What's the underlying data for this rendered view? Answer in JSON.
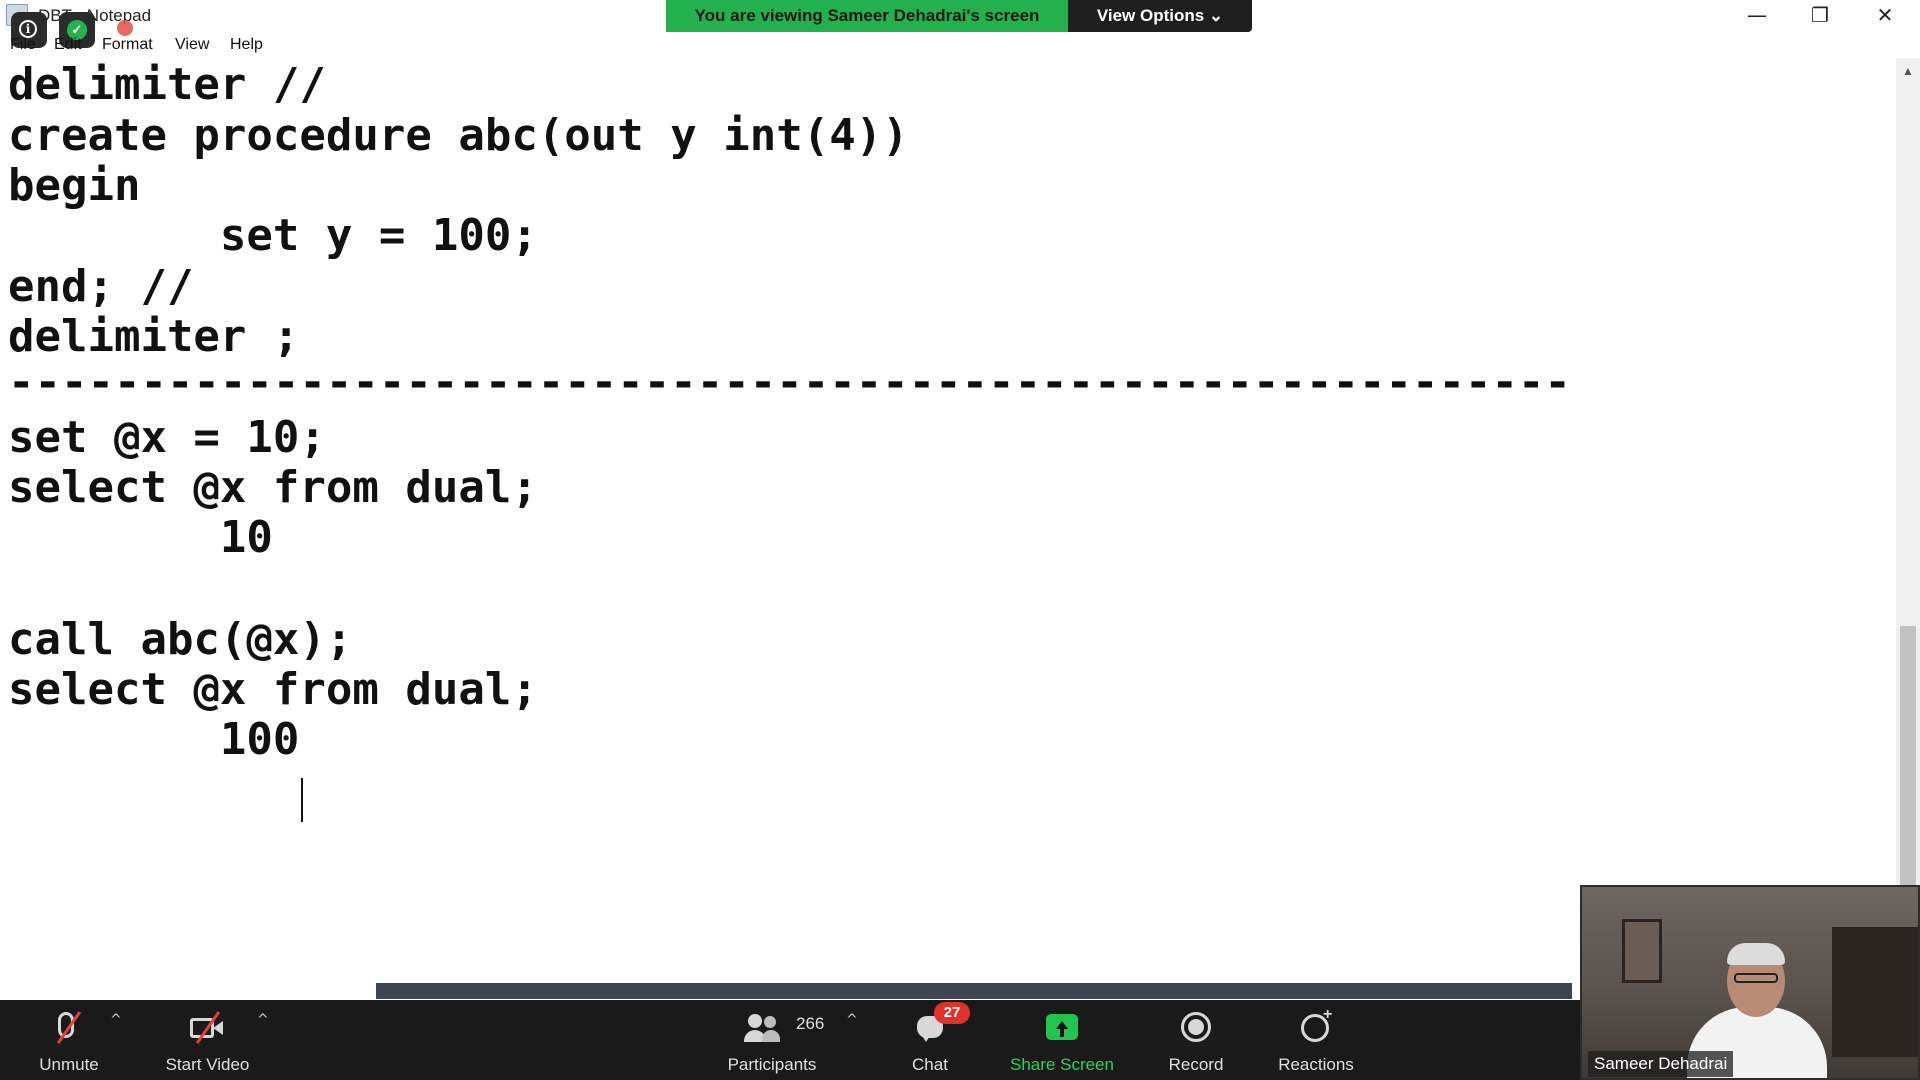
{
  "window": {
    "title": "DBT - Notepad",
    "minimize_glyph": "—",
    "maximize_glyph": "❐",
    "close_glyph": "✕"
  },
  "share_banner": {
    "viewing_text": "You are viewing Sameer Dehadrai's screen",
    "view_options_label": "View Options ⌄"
  },
  "overlay_icons": {
    "info": "i",
    "shield": "✓"
  },
  "menu": {
    "items": [
      "File",
      "Edit",
      "Format",
      "View",
      "Help"
    ]
  },
  "editor": {
    "lines": [
      "delimiter //",
      "create procedure abc(out y int(4))",
      "begin",
      "        set y = 100;",
      "end; //",
      "delimiter ;",
      "-----------------------------------------------------------",
      "set @x = 10;",
      "select @x from dual;",
      "        10",
      "",
      "call abc(@x);",
      "select @x from dual;",
      "        100"
    ]
  },
  "toolbar": {
    "unmute_label": "Unmute",
    "start_video_label": "Start Video",
    "participants_count": "266",
    "participants_label": "Participants",
    "chat_label": "Chat",
    "chat_badge": "27",
    "share_screen_label": "Share Screen",
    "record_label": "Record",
    "reactions_label": "Reactions",
    "caret": "^"
  },
  "video": {
    "name": "Sameer Dehadrai"
  },
  "colors": {
    "banner_green": "#23b14d",
    "share_green": "#23c552",
    "toolbar_bg": "#1a1a1a",
    "badge_red": "#e0322b"
  }
}
